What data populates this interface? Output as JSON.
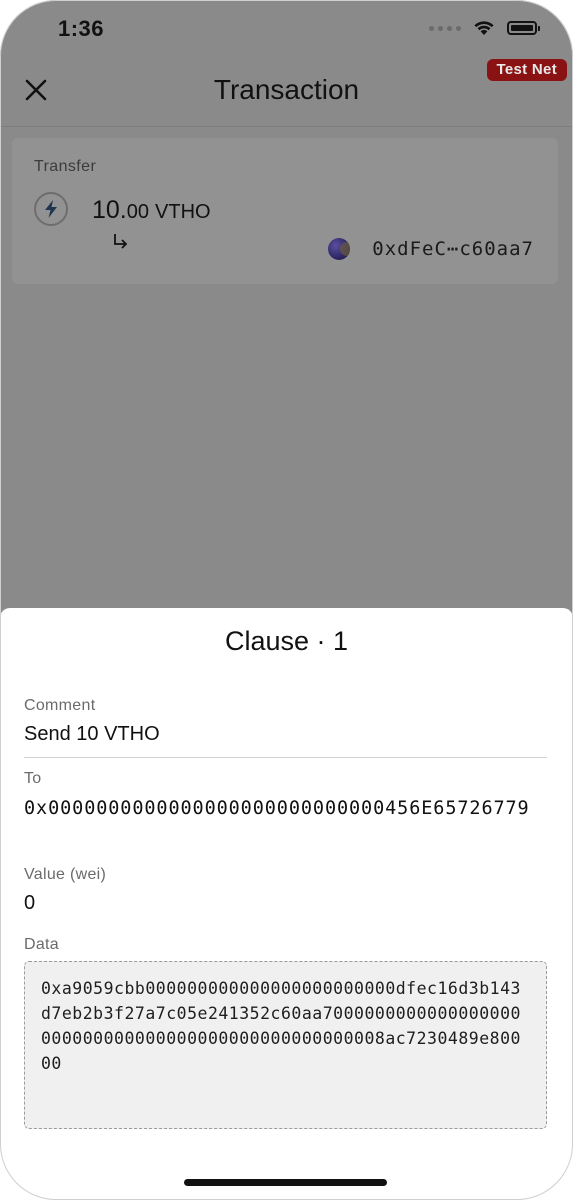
{
  "status_bar": {
    "time": "1:36"
  },
  "badge": {
    "network": "Test Net"
  },
  "nav": {
    "title": "Transaction"
  },
  "transfer": {
    "label": "Transfer",
    "amount_int": "10.",
    "amount_dec": "00",
    "symbol": "VTHO",
    "recipient_address": "0xdFeC⋯c60aa7"
  },
  "clause": {
    "title": "Clause · 1",
    "comment_label": "Comment",
    "comment_value": "Send 10 VTHO",
    "to_label": "To",
    "to_value": "0x0000000000000000000000000000456E65726779",
    "value_label": "Value (wei)",
    "value_value": "0",
    "data_label": "Data",
    "data_value": "0xa9059cbb000000000000000000000000dfec16d3b143d7eb2b3f27a7c05e241352c60aa7000000000000000000000000000000000000000000000000008ac7230489e80000"
  },
  "colors": {
    "badge_bg": "#8a1212",
    "overlay_bg": "#8a8a8a",
    "card_bg": "#929292"
  },
  "icons": {
    "close": "close-icon",
    "token": "vtho-lightning-icon",
    "arrow": "return-arrow-icon",
    "wifi": "wifi-icon",
    "battery": "battery-icon",
    "signal": "signal-icon"
  }
}
